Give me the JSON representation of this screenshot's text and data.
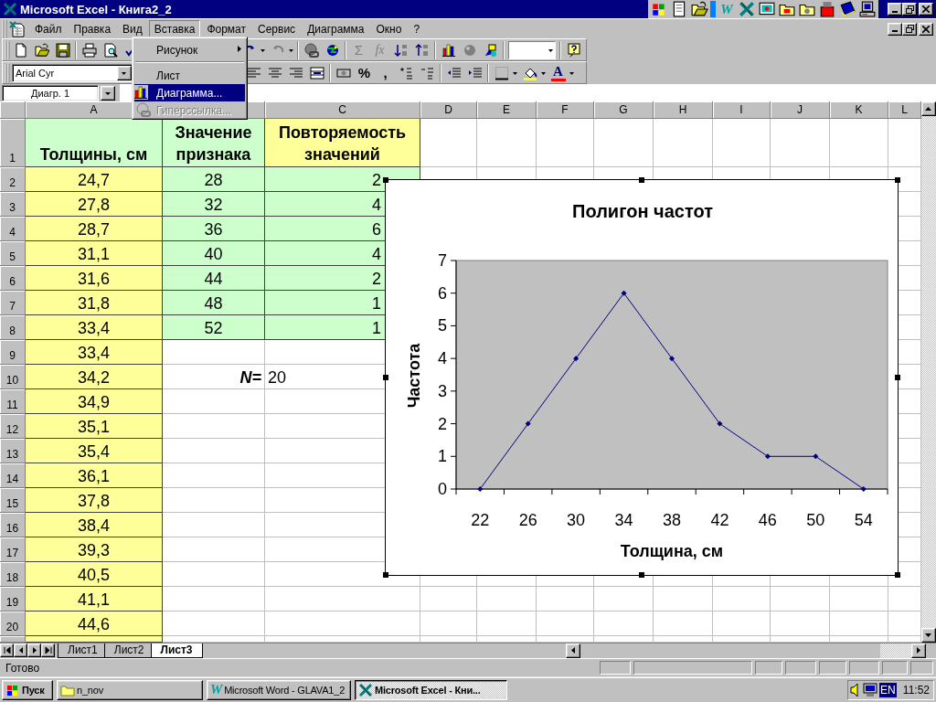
{
  "window": {
    "title": "Microsoft Excel - Книга2_2"
  },
  "office_bar": {
    "word_glyph": "W"
  },
  "menu_bar": {
    "items": [
      {
        "label": "Файл",
        "selected": false
      },
      {
        "label": "Правка",
        "selected": false
      },
      {
        "label": "Вид",
        "selected": false
      },
      {
        "label": "Вставка",
        "selected": true
      },
      {
        "label": "Формат",
        "selected": false
      },
      {
        "label": "Сервис",
        "selected": false
      },
      {
        "label": "Диаграмма",
        "selected": false
      },
      {
        "label": "Окно",
        "selected": false
      },
      {
        "label": "?",
        "selected": false
      }
    ]
  },
  "insert_menu": {
    "items": [
      {
        "kind": "submenu",
        "label": "Рисунок",
        "selected": false,
        "disabled": false
      },
      {
        "kind": "separator"
      },
      {
        "kind": "plain",
        "label": "Лист",
        "selected": false,
        "disabled": false
      },
      {
        "kind": "chart",
        "label": "Диаграмма...",
        "selected": true,
        "disabled": false
      },
      {
        "kind": "link",
        "label": "Гиперссылка...",
        "selected": false,
        "disabled": true
      }
    ]
  },
  "standard_toolbar": {
    "sum_button": "Σ",
    "function_button": "fx"
  },
  "formatting_toolbar": {
    "font": "Arial Cyr",
    "percent_button": "%",
    "comma_button": ",",
    "font_color_button": "A"
  },
  "name_box": {
    "value": "Диагр. 1"
  },
  "sheet": {
    "columns": [
      {
        "label": "A"
      },
      {},
      {
        "label": "C"
      },
      {
        "label": "D"
      },
      {
        "label": "E"
      },
      {
        "label": "F"
      },
      {
        "label": "G"
      },
      {
        "label": "H"
      },
      {
        "label": "I"
      },
      {
        "label": "J"
      },
      {
        "label": "K"
      },
      {
        "label": "L"
      }
    ],
    "rows": [
      {
        "header": "1",
        "cells": [
          {
            "text": "Толщины, см",
            "kind": "header",
            "color": "#ccffcc"
          },
          {
            "text": "Значение признака",
            "kind": "header",
            "color": "#ccffcc"
          },
          {
            "text": "Повторяемость значений",
            "kind": "header",
            "color": "#ffff99"
          }
        ]
      },
      {
        "header": "2",
        "cells": [
          {
            "text": "24,7",
            "kind": "number",
            "color": "#ffff99"
          },
          {
            "text": "28",
            "kind": "number",
            "color": "#ccffcc"
          },
          {
            "text": "2",
            "kind": "number",
            "color": "#ccffcc"
          }
        ]
      },
      {
        "header": "3",
        "cells": [
          {
            "text": "27,8",
            "kind": "number",
            "color": "#ffff99"
          },
          {
            "text": "32",
            "kind": "number",
            "color": "#ccffcc"
          },
          {
            "text": "4",
            "kind": "number",
            "color": "#ccffcc"
          }
        ]
      },
      {
        "header": "4",
        "cells": [
          {
            "text": "28,7",
            "kind": "number",
            "color": "#ffff99"
          },
          {
            "text": "36",
            "kind": "number",
            "color": "#ccffcc"
          },
          {
            "text": "6",
            "kind": "number",
            "color": "#ccffcc"
          }
        ]
      },
      {
        "header": "5",
        "cells": [
          {
            "text": "31,1",
            "kind": "number",
            "color": "#ffff99"
          },
          {
            "text": "40",
            "kind": "number",
            "color": "#ccffcc"
          },
          {
            "text": "4",
            "kind": "number",
            "color": "#ccffcc"
          }
        ]
      },
      {
        "header": "6",
        "cells": [
          {
            "text": "31,6",
            "kind": "number",
            "color": "#ffff99"
          },
          {
            "text": "44",
            "kind": "number",
            "color": "#ccffcc"
          },
          {
            "text": "2",
            "kind": "number",
            "color": "#ccffcc"
          }
        ]
      },
      {
        "header": "7",
        "cells": [
          {
            "text": "31,8",
            "kind": "number",
            "color": "#ffff99"
          },
          {
            "text": "48",
            "kind": "number",
            "color": "#ccffcc"
          },
          {
            "text": "1",
            "kind": "number",
            "color": "#ccffcc"
          }
        ]
      },
      {
        "header": "8",
        "cells": [
          {
            "text": "33,4",
            "kind": "number",
            "color": "#ffff99"
          },
          {
            "text": "52",
            "kind": "number",
            "color": "#ccffcc"
          },
          {
            "text": "1",
            "kind": "number",
            "color": "#ccffcc"
          }
        ]
      },
      {
        "header": "9",
        "cells": [
          {
            "text": "33,4",
            "kind": "number",
            "color": "#ffff99"
          },
          null,
          null
        ]
      },
      {
        "header": "10",
        "cells": [
          {
            "text": "34,2",
            "kind": "number",
            "color": "#ffff99"
          },
          {
            "text": "N=",
            "kind": "label"
          },
          {
            "text": "20",
            "kind": "text"
          }
        ]
      },
      {
        "header": "11",
        "cells": [
          {
            "text": "34,9",
            "kind": "number",
            "color": "#ffff99"
          },
          null,
          null
        ]
      },
      {
        "header": "12",
        "cells": [
          {
            "text": "35,1",
            "kind": "number",
            "color": "#ffff99"
          },
          null,
          null
        ]
      },
      {
        "header": "13",
        "cells": [
          {
            "text": "35,4",
            "kind": "number",
            "color": "#ffff99"
          },
          null,
          null
        ]
      },
      {
        "header": "14",
        "cells": [
          {
            "text": "36,1",
            "kind": "number",
            "color": "#ffff99"
          },
          null,
          null
        ]
      },
      {
        "header": "15",
        "cells": [
          {
            "text": "37,8",
            "kind": "number",
            "color": "#ffff99"
          },
          null,
          null
        ]
      },
      {
        "header": "16",
        "cells": [
          {
            "text": "38,4",
            "kind": "number",
            "color": "#ffff99"
          },
          null,
          null
        ]
      },
      {
        "header": "17",
        "cells": [
          {
            "text": "39,3",
            "kind": "number",
            "color": "#ffff99"
          },
          null,
          null
        ]
      },
      {
        "header": "18",
        "cells": [
          {
            "text": "40,5",
            "kind": "number",
            "color": "#ffff99"
          },
          null,
          null
        ]
      },
      {
        "header": "19",
        "cells": [
          {
            "text": "41,1",
            "kind": "number",
            "color": "#ffff99"
          },
          null,
          null
        ]
      },
      {
        "header": "20",
        "cells": [
          {
            "text": "44,6",
            "kind": "number",
            "color": "#ffff99"
          },
          null,
          null
        ]
      },
      {
        "cells": [
          {
            "kind": "number",
            "color": "#ffff99"
          },
          null,
          null
        ]
      }
    ]
  },
  "chart": {
    "chart_data": {
      "type": "line",
      "title": "Полигон частот",
      "xlabel": "Толщина, см",
      "ylabel": "Частота",
      "categories": [
        "22",
        "26",
        "30",
        "34",
        "38",
        "42",
        "46",
        "50",
        "54"
      ],
      "series": [
        {
          "color": "#000080",
          "marker": "diamond",
          "values": [
            0,
            2,
            4,
            6,
            4,
            2,
            1,
            1,
            0
          ]
        }
      ],
      "ylim": [
        0,
        7
      ],
      "yticks": [
        0,
        1,
        2,
        3,
        4,
        5,
        6,
        7
      ]
    }
  },
  "sheet_tabs": [
    {
      "label": "Лист1",
      "selected": false
    },
    {
      "label": "Лист2",
      "selected": false
    },
    {
      "label": "Лист3",
      "selected": true
    }
  ],
  "status_bar": {
    "text": "Готово"
  },
  "taskbar": {
    "start": "Пуск",
    "buttons": [
      {
        "kind": "folder",
        "label": "n_nov",
        "selected": false
      },
      {
        "kind": "word",
        "glyph": "W",
        "label": "Microsoft Word - GLAVA1_2",
        "selected": false
      },
      {
        "kind": "excel",
        "label": "Microsoft Excel - Кни...",
        "selected": true
      }
    ],
    "language": "EN",
    "clock": "11:52"
  }
}
